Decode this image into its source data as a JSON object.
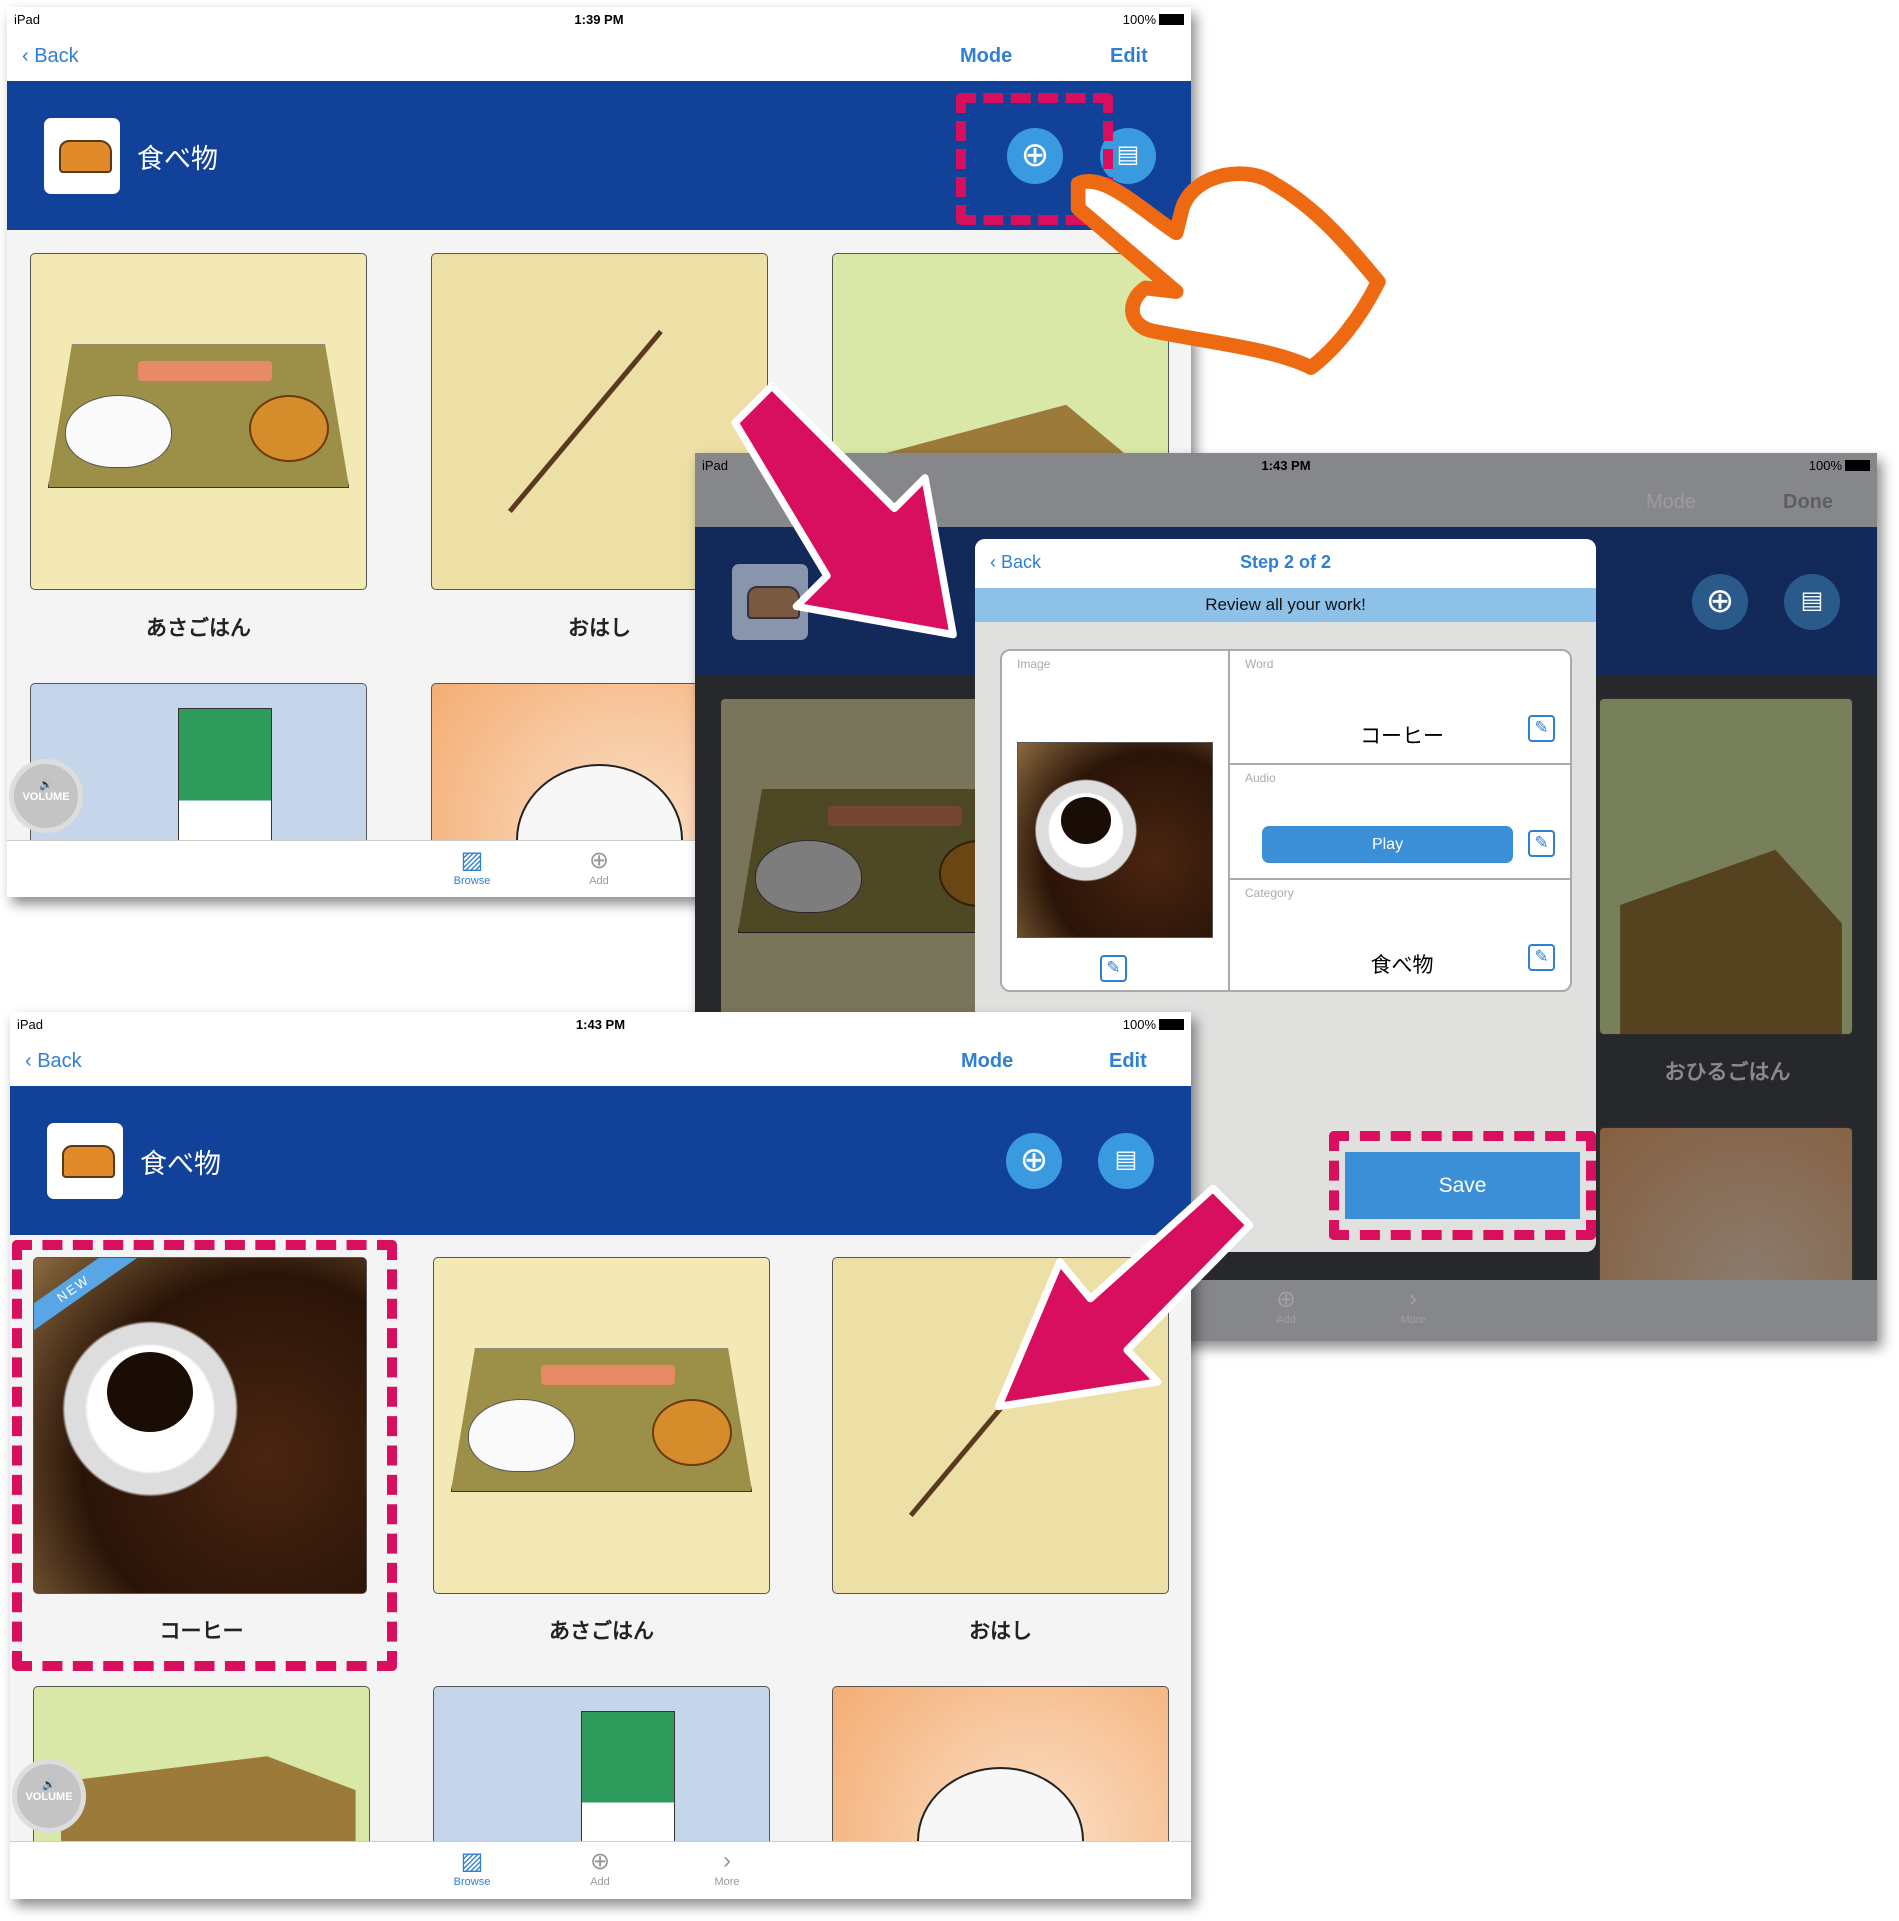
{
  "colors": {
    "accent": "#2f7fd3",
    "header": "#12419a",
    "highlight": "#d80f5e",
    "pointer": "#ee6a12"
  },
  "screen1": {
    "status": {
      "device": "iPad",
      "time": "1:39 PM",
      "battery": "100%"
    },
    "nav": {
      "back": "Back",
      "mode": "Mode",
      "edit": "Edit"
    },
    "header": {
      "title": "食べ物",
      "add_icon": "plus-circle-icon",
      "print_icon": "printer-icon"
    },
    "tiles": [
      {
        "label": "あさごはん"
      },
      {
        "label": "おはし"
      },
      {
        "label": ""
      }
    ],
    "volume": "VOLUME",
    "tabs": [
      {
        "label": "Browse",
        "icon": "browse-icon",
        "active": true
      },
      {
        "label": "Add",
        "icon": "plus-circle-icon"
      }
    ]
  },
  "screen2": {
    "status": {
      "device": "iPad",
      "time": "1:43 PM",
      "battery": "100%"
    },
    "nav": {
      "mode": "Mode",
      "done": "Done"
    },
    "tile_label": "おひるごはん",
    "tabs": [
      {
        "label": "Add"
      },
      {
        "label": "More"
      }
    ],
    "modal": {
      "back": "Back",
      "title": "Step 2 of 2",
      "banner": "Review all your work!",
      "image_caption": "Image",
      "word_caption": "Word",
      "word": "コーヒー",
      "audio_caption": "Audio",
      "play": "Play",
      "category_caption": "Category",
      "category": "食べ物",
      "save": "Save"
    }
  },
  "screen3": {
    "status": {
      "device": "iPad",
      "time": "1:43 PM",
      "battery": "100%"
    },
    "nav": {
      "back": "Back",
      "mode": "Mode",
      "edit": "Edit"
    },
    "header": {
      "title": "食べ物"
    },
    "new_badge": "NEW",
    "tiles": [
      {
        "label": "コーヒー"
      },
      {
        "label": "あさごはん"
      },
      {
        "label": "おはし"
      }
    ],
    "volume": "VOLUME",
    "tabs": [
      {
        "label": "Browse",
        "active": true
      },
      {
        "label": "Add"
      },
      {
        "label": "More"
      }
    ]
  }
}
